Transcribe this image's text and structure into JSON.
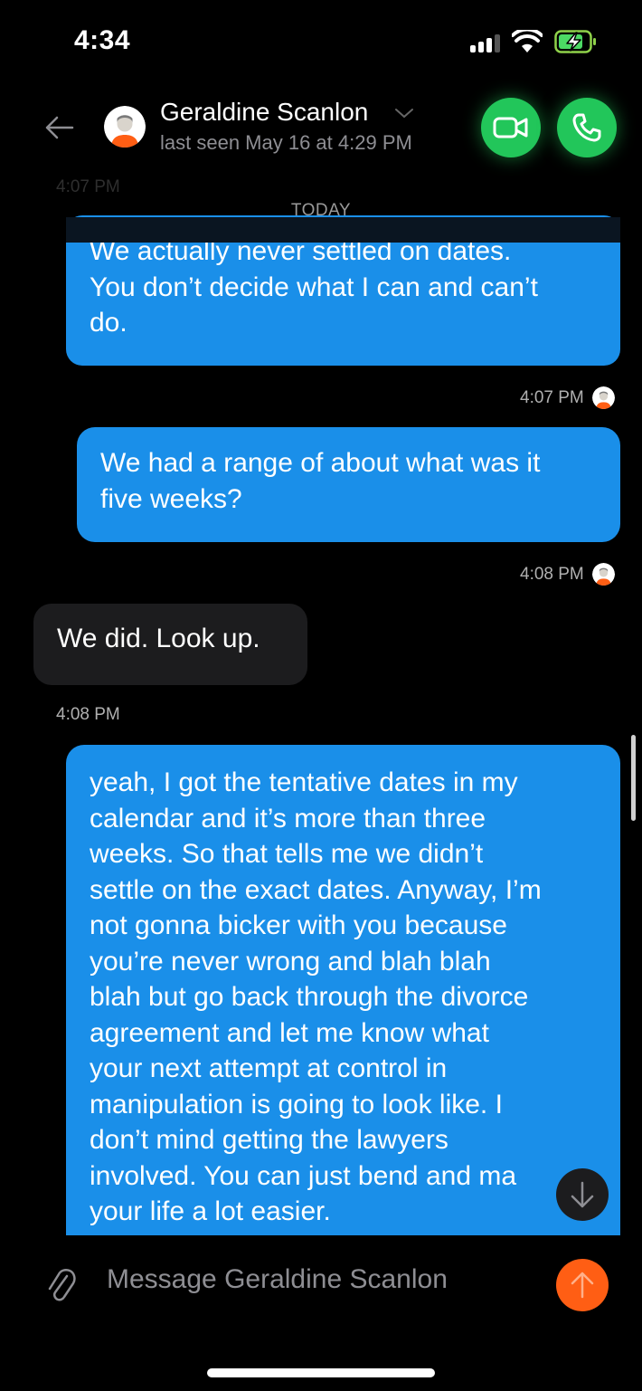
{
  "status_bar": {
    "time": "4:34"
  },
  "header": {
    "contact_name": "Geraldine Scanlon",
    "last_seen": "last seen May 16 at 4:29 PM",
    "icons": {
      "back": "arrow-left-icon",
      "dropdown": "chevron-down-icon",
      "video_call": "video-camera-icon",
      "voice_call": "phone-icon"
    },
    "accent_color": "#22c65a"
  },
  "chat": {
    "partial_timestamp": "4:07 PM",
    "date_divider": "TODAY",
    "messages": [
      {
        "direction": "outgoing",
        "lines": [
          "We actually never settled on dates.",
          "You don’t decide what I can and can’t",
          "do."
        ],
        "time": "4:07 PM",
        "read": true
      },
      {
        "direction": "outgoing",
        "lines": [
          "We had a range of about what was it",
          "five weeks?"
        ],
        "time": "4:08 PM",
        "read": true
      },
      {
        "direction": "incoming",
        "lines": [
          "We did. Look up."
        ],
        "time": "4:08 PM"
      },
      {
        "direction": "outgoing",
        "lines": [
          "yeah, I got the tentative dates in my",
          "calendar and it’s more than three",
          "weeks. So that tells me we didn’t",
          "settle on the exact dates. Anyway, I’m",
          "not gonna bicker with you because",
          "you’re never wrong and blah blah",
          "blah but go back through the divorce",
          "agreement and let me know what",
          "your next attempt at control in",
          "manipulation is going to look like. I",
          "don’t mind getting the lawyers",
          "involved. You can just bend and ma",
          "your life a lot easier."
        ]
      }
    ],
    "colors": {
      "outgoing_bubble": "#1a8fe9",
      "incoming_bubble": "#1c1c1e"
    }
  },
  "composer": {
    "placeholder": "Message Geraldine Scanlon",
    "icons": {
      "attach": "paperclip-icon",
      "send": "arrow-up-icon",
      "scroll_down": "arrow-down-icon"
    },
    "send_color": "#ff5e14"
  }
}
